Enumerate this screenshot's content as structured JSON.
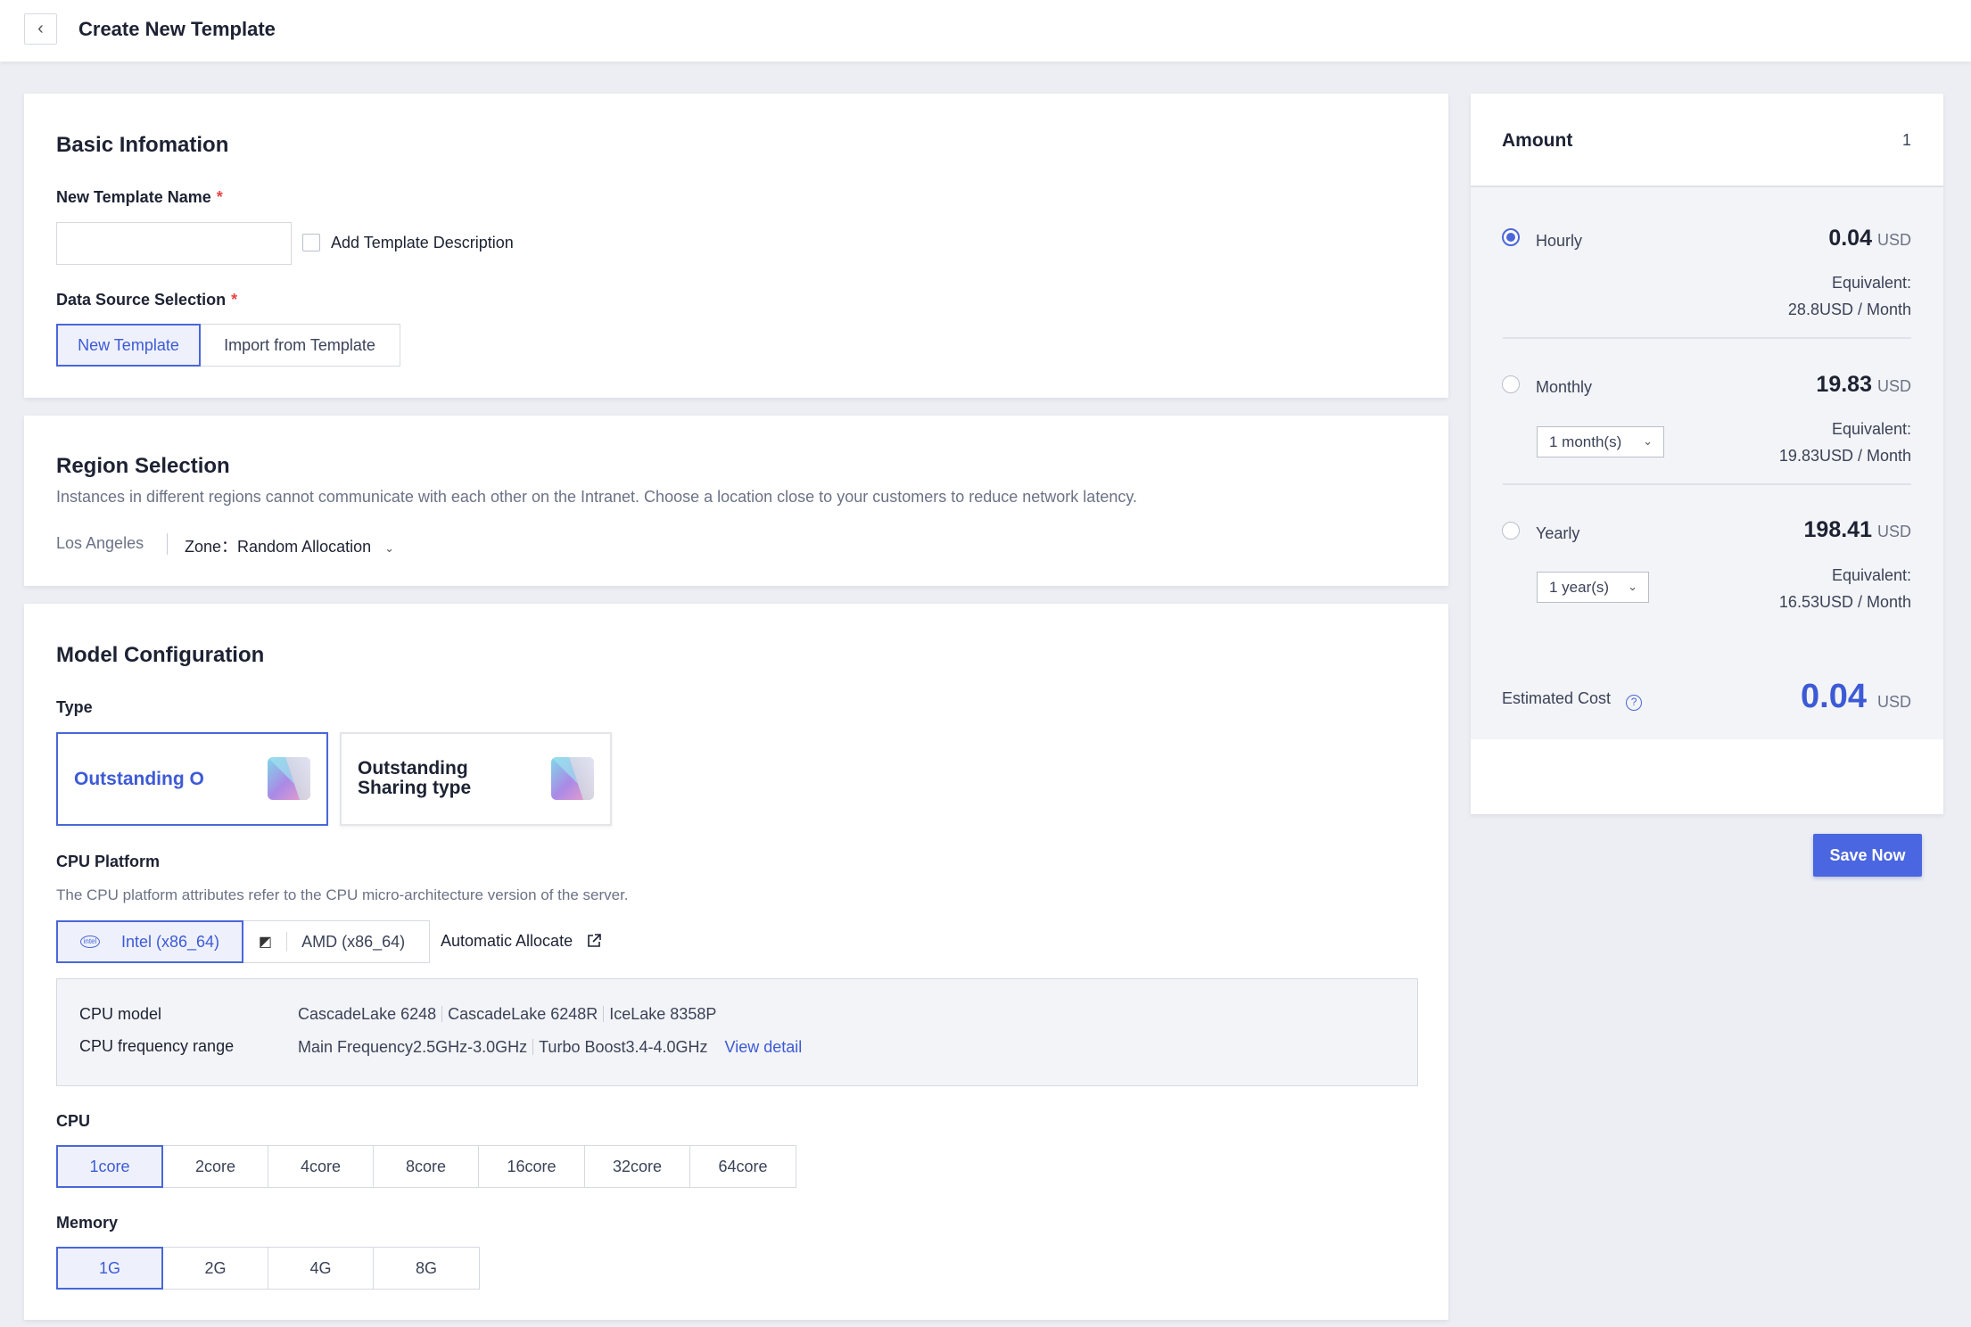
{
  "header": {
    "back_icon": "chevron-left-icon",
    "title": "Create New Template"
  },
  "basic": {
    "title": "Basic Infomation",
    "name_label": "New Template Name",
    "required_mark": "*",
    "name_value": "",
    "add_description_label": "Add Template Description",
    "add_description_checked": false,
    "source_label": "Data Source Selection",
    "source_options": [
      "New Template",
      "Import from Template"
    ],
    "source_selected": "New Template"
  },
  "region": {
    "title": "Region Selection",
    "description": "Instances in different regions cannot communicate with each other on the Intranet. Choose a location close to your customers to reduce network latency.",
    "location": "Los Angeles",
    "zone_label": "Zone：",
    "zone_value": "Random Allocation"
  },
  "model": {
    "title": "Model Configuration",
    "type_label": "Type",
    "types": [
      "Outstanding O",
      "Outstanding Sharing type"
    ],
    "type_selected": "Outstanding O",
    "cpu_platform_label": "CPU Platform",
    "cpu_platform_desc": "The CPU platform attributes refer to the CPU micro-architecture version of the server.",
    "platforms": [
      "Intel (x86_64)",
      "AMD (x86_64)"
    ],
    "platform_selected": "Intel (x86_64)",
    "auto_allocate": "Automatic Allocate",
    "cpu_model_key": "CPU model",
    "cpu_models": [
      "CascadeLake 6248",
      "CascadeLake 6248R",
      "IceLake 8358P"
    ],
    "cpu_freq_key": "CPU frequency range",
    "cpu_freqs": [
      "Main Frequency2.5GHz-3.0GHz",
      "Turbo Boost3.4-4.0GHz"
    ],
    "view_detail": "View detail",
    "cpu_label": "CPU",
    "cpu_options": [
      "1core",
      "2core",
      "4core",
      "8core",
      "16core",
      "32core",
      "64core"
    ],
    "cpu_selected": "1core",
    "memory_label": "Memory",
    "memory_options": [
      "1G",
      "2G",
      "4G",
      "8G"
    ],
    "memory_selected": "1G"
  },
  "pricing": {
    "amount_label": "Amount",
    "amount_value": "1",
    "currency": "USD",
    "equivalent_label": "Equivalent:",
    "plans": [
      {
        "name": "Hourly",
        "price": "0.04",
        "equivalent": "28.8USD / Month",
        "selected": true
      },
      {
        "name": "Monthly",
        "price": "19.83",
        "equivalent": "19.83USD / Month",
        "duration": "1 month(s)",
        "selected": false
      },
      {
        "name": "Yearly",
        "price": "198.41",
        "equivalent": "16.53USD / Month",
        "duration": "1 year(s)",
        "selected": false
      }
    ],
    "estimated_label": "Estimated Cost",
    "estimated_value": "0.04",
    "save_label": "Save Now",
    "accent_color": "#4a66d9"
  }
}
